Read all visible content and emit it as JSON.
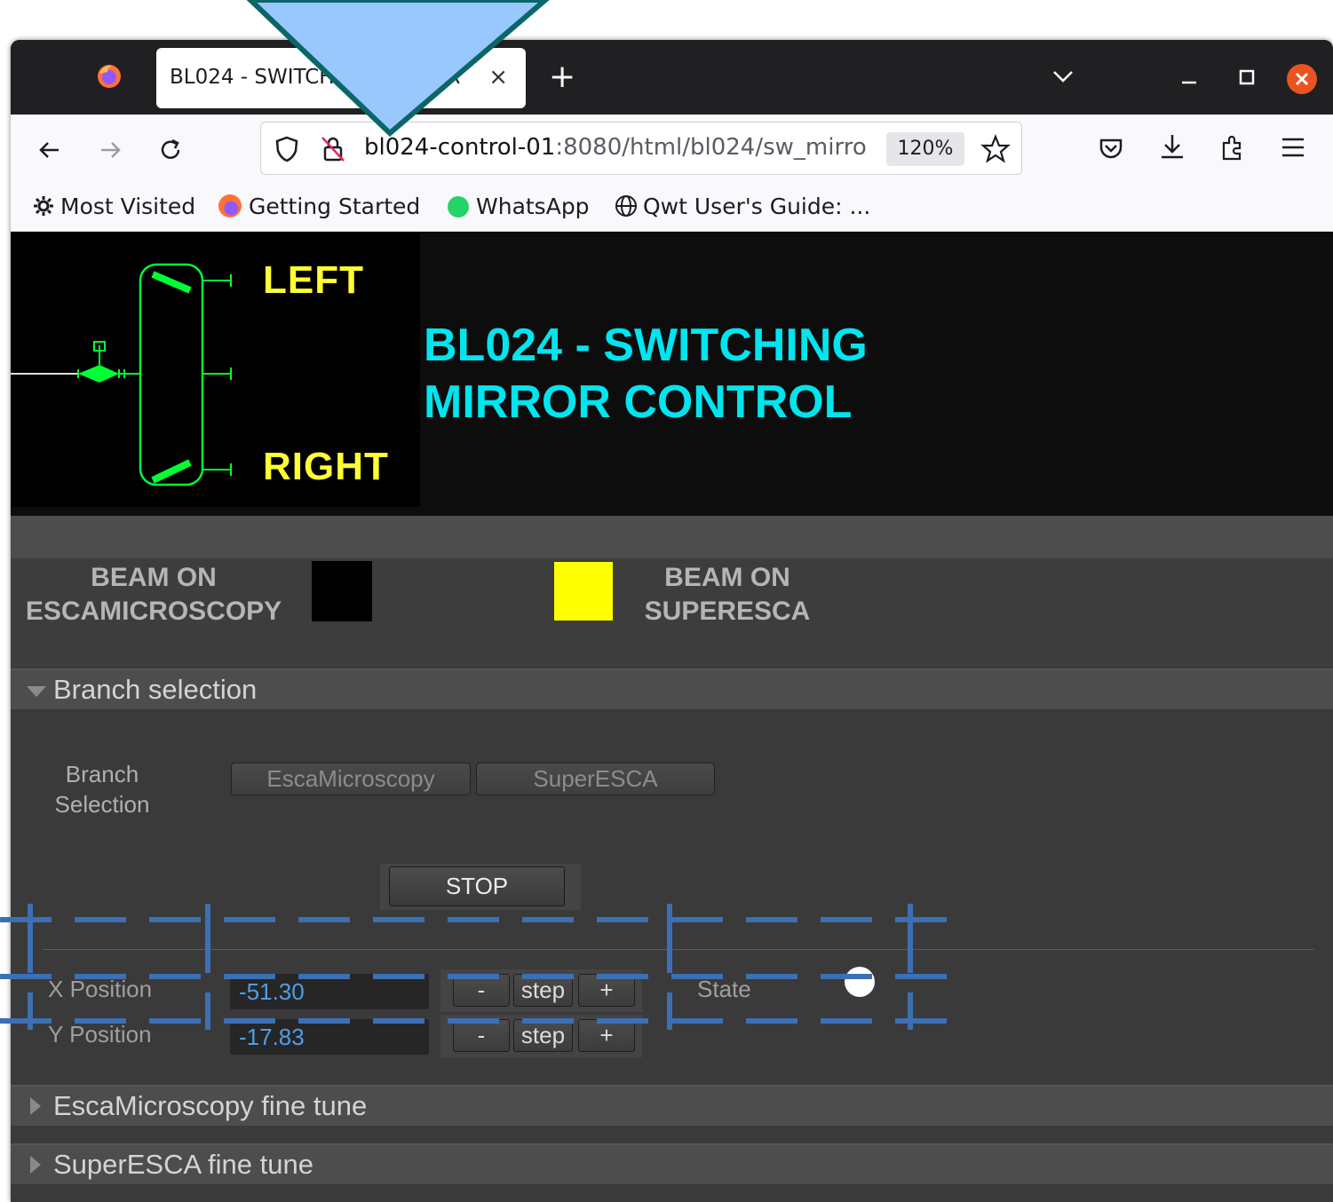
{
  "browser": {
    "tab_title": "BL024 - SWITCHING MIRROR",
    "tab_close": "×",
    "new_tab": "+",
    "url_host": "bl024-control-01",
    "url_path": ":8080/html/bl024/sw_mirro",
    "zoom": "120%",
    "bookmarks": [
      {
        "label": "Most Visited",
        "icon": "gear-icon"
      },
      {
        "label": "Getting Started",
        "icon": "firefox-icon"
      },
      {
        "label": "WhatsApp",
        "icon": "whatsapp-icon"
      },
      {
        "label": "Qwt User's Guide: ...",
        "icon": "globe-icon"
      }
    ]
  },
  "header": {
    "synoptic_left": "LEFT",
    "synoptic_right": "RIGHT",
    "title_line1": "BL024 - SWITCHING",
    "title_line2": "MIRROR CONTROL"
  },
  "beam": {
    "escamicroscopy": {
      "line1": "BEAM ON",
      "line2": "ESCAMICROSCOPY",
      "color": "#000000"
    },
    "superesca": {
      "line1": "BEAM ON",
      "line2": "SUPERESCA",
      "color": "#ffff00"
    }
  },
  "branch_section": {
    "title": "Branch selection",
    "label_line1": "Branch",
    "label_line2": "Selection",
    "btn_esca": "EscaMicroscopy",
    "btn_super": "SuperESCA",
    "btn_stop": "STOP"
  },
  "positions": {
    "x_label": "X Position",
    "x_value": "-51.30",
    "y_label": "Y Position",
    "y_value": "-17.83",
    "minus": "-",
    "step": "step",
    "plus": "+",
    "state_label": "State",
    "state_color": "#ffffff"
  },
  "sections": {
    "esca_fine": "EscaMicroscopy fine tune",
    "super_fine": "SuperESCA fine tune"
  },
  "colors": {
    "title_cyan": "#00e5ee",
    "synoptic_yellow": "#ffff33",
    "synoptic_green": "#00ff33",
    "value_blue": "#4f9ee8",
    "overlay_blue": "#99c8ff",
    "dash_blue": "#3d6fb4"
  }
}
